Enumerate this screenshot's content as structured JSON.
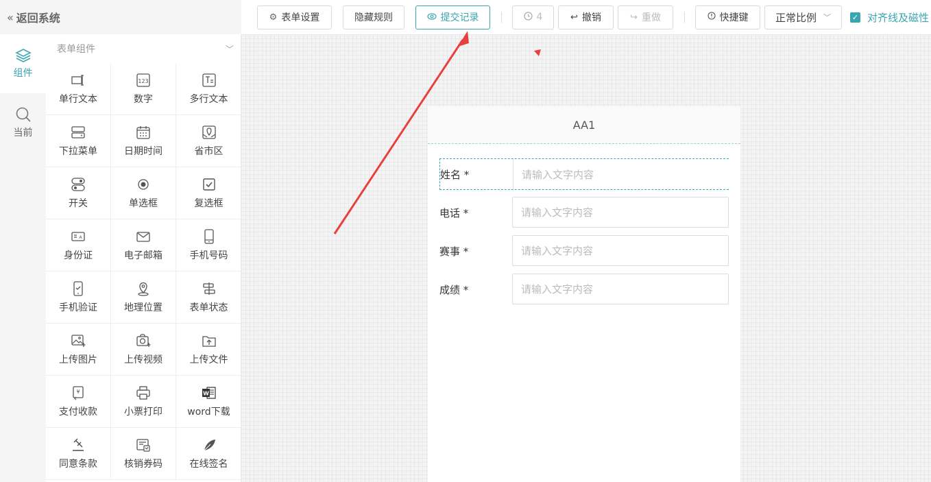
{
  "header": {
    "back_label": "返回系统"
  },
  "toolbar": {
    "form_settings": "表单设置",
    "hide_rules": "隐藏规则",
    "submit_records": "提交记录",
    "history_count": "4",
    "undo": "撤销",
    "redo": "重做",
    "shortcuts": "快捷键",
    "zoom": "正常比例",
    "align_snap": "对齐线及磁性"
  },
  "rail": {
    "components": "组件",
    "current": "当前"
  },
  "panel": {
    "title": "表单组件",
    "items": [
      {
        "label": "单行文本",
        "icon": "single-line-text-icon"
      },
      {
        "label": "数字",
        "icon": "number-icon"
      },
      {
        "label": "多行文本",
        "icon": "multi-line-text-icon"
      },
      {
        "label": "下拉菜单",
        "icon": "dropdown-icon"
      },
      {
        "label": "日期时间",
        "icon": "calendar-icon"
      },
      {
        "label": "省市区",
        "icon": "map-region-icon"
      },
      {
        "label": "开关",
        "icon": "switch-icon"
      },
      {
        "label": "单选框",
        "icon": "radio-icon"
      },
      {
        "label": "复选框",
        "icon": "checkbox-icon"
      },
      {
        "label": "身份证",
        "icon": "id-card-icon"
      },
      {
        "label": "电子邮箱",
        "icon": "email-icon"
      },
      {
        "label": "手机号码",
        "icon": "mobile-icon"
      },
      {
        "label": "手机验证",
        "icon": "mobile-verify-icon"
      },
      {
        "label": "地理位置",
        "icon": "location-icon"
      },
      {
        "label": "表单状态",
        "icon": "form-status-icon"
      },
      {
        "label": "上传图片",
        "icon": "upload-image-icon"
      },
      {
        "label": "上传视频",
        "icon": "upload-video-icon"
      },
      {
        "label": "上传文件",
        "icon": "upload-file-icon"
      },
      {
        "label": "支付收款",
        "icon": "payment-icon"
      },
      {
        "label": "小票打印",
        "icon": "printer-icon"
      },
      {
        "label": "word下载",
        "icon": "word-icon"
      },
      {
        "label": "同意条款",
        "icon": "gavel-icon"
      },
      {
        "label": "核销券码",
        "icon": "coupon-icon"
      },
      {
        "label": "在线签名",
        "icon": "feather-icon"
      }
    ]
  },
  "form": {
    "title": "AA1",
    "fields": [
      {
        "label": "姓名 *",
        "placeholder": "请输入文字内容"
      },
      {
        "label": "电话 *",
        "placeholder": "请输入文字内容"
      },
      {
        "label": "赛事 *",
        "placeholder": "请输入文字内容"
      },
      {
        "label": "成绩 *",
        "placeholder": "请输入文字内容"
      }
    ]
  },
  "colors": {
    "accent": "#3aa7b0",
    "annotation": "#e8403a"
  }
}
